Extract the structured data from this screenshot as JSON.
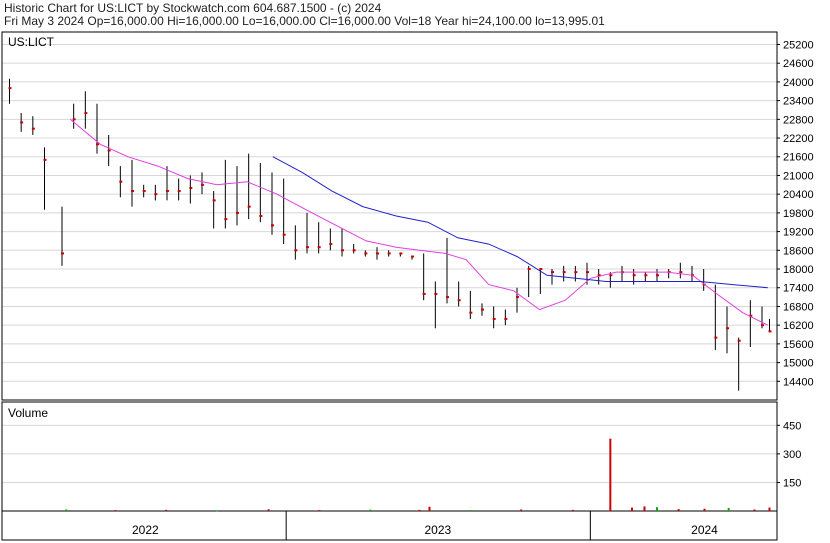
{
  "header": {
    "line1": "Historic Chart for US:LICT by Stockwatch.com 604.687.1500 - (c) 2024",
    "line2": "Fri May  3 2024  Op=16,000.00  Hi=16,000.00  Lo=16,000.00  Cl=16,000.00  Vol=18  Year hi=24,100.00  lo=13,995.01"
  },
  "colors": {
    "price_bars": "#000000",
    "close_marks": "#cc0000",
    "ma_short": "#e040e0",
    "ma_long": "#2222cc",
    "volume_up": "#00aa00",
    "volume_down": "#cc0000",
    "frame": "#000000",
    "grid": "#d8d8d8"
  },
  "chart_data": [
    {
      "type": "line",
      "title": "US:LICT",
      "ylim": [
        13800,
        25600
      ],
      "y_ticks": [
        14400,
        15000,
        15600,
        16200,
        16800,
        17400,
        18000,
        18600,
        19200,
        19800,
        20400,
        21000,
        21600,
        22200,
        22800,
        23400,
        24000,
        24600,
        25200
      ],
      "x_labels": [
        "2022",
        "2023",
        "2024"
      ],
      "grid": true,
      "series": [
        {
          "kind": "ohlc",
          "x": [
            "2021-11-03",
            "2021-11-17",
            "2021-12-01",
            "2021-12-15",
            "2022-01-05",
            "2022-01-19",
            "2022-02-02",
            "2022-02-16",
            "2022-03-02",
            "2022-03-16",
            "2022-03-30",
            "2022-04-13",
            "2022-04-27",
            "2022-05-11",
            "2022-05-25",
            "2022-06-08",
            "2022-06-22",
            "2022-07-06",
            "2022-07-20",
            "2022-08-03",
            "2022-08-17",
            "2022-08-31",
            "2022-09-14",
            "2022-09-28",
            "2022-10-12",
            "2022-10-26",
            "2022-11-09",
            "2022-11-23",
            "2022-12-07",
            "2022-12-21",
            "2023-01-04",
            "2023-01-18",
            "2023-02-01",
            "2023-02-15",
            "2023-03-01",
            "2023-03-15",
            "2023-03-29",
            "2023-04-12",
            "2023-04-26",
            "2023-05-10",
            "2023-05-24",
            "2023-06-07",
            "2023-06-21",
            "2023-07-05",
            "2023-07-19",
            "2023-08-02",
            "2023-08-16",
            "2023-08-30",
            "2023-09-13",
            "2023-09-27",
            "2023-10-11",
            "2023-10-25",
            "2023-11-08",
            "2023-11-22",
            "2023-12-06",
            "2023-12-20",
            "2024-01-03",
            "2024-01-17",
            "2024-01-31",
            "2024-02-14",
            "2024-02-28",
            "2024-03-13",
            "2024-03-27",
            "2024-04-10",
            "2024-04-24",
            "2024-05-03"
          ],
          "high": [
            24100,
            23000,
            22900,
            21900,
            20000,
            23300,
            23700,
            23300,
            22300,
            21300,
            21500,
            20700,
            20700,
            21300,
            20900,
            21000,
            21100,
            20500,
            21500,
            21300,
            21700,
            21400,
            21100,
            20900,
            19400,
            19800,
            19500,
            19300,
            19300,
            18800,
            18600,
            18700,
            18600,
            18500,
            18400,
            18500,
            17600,
            19000,
            17600,
            17300,
            16900,
            16800,
            16700,
            17400,
            18100,
            18000,
            18000,
            18100,
            18100,
            18200,
            18000,
            17900,
            18100,
            18000,
            17900,
            18000,
            18000,
            18200,
            18100,
            18000,
            17500,
            16800,
            15800,
            17000,
            16800,
            16400
          ],
          "low": [
            23300,
            22400,
            22300,
            19900,
            18100,
            22500,
            22500,
            21700,
            21300,
            20300,
            20000,
            20300,
            20200,
            20200,
            20200,
            20100,
            20400,
            19300,
            19300,
            19400,
            19600,
            19500,
            19100,
            18800,
            18300,
            18500,
            18500,
            18600,
            18400,
            18500,
            18400,
            18300,
            18400,
            18400,
            18300,
            17000,
            16100,
            16900,
            16800,
            16400,
            16500,
            16100,
            16200,
            16600,
            17100,
            17200,
            17500,
            17600,
            17600,
            17500,
            17500,
            17400,
            17600,
            17500,
            17600,
            17600,
            17700,
            17700,
            17600,
            17300,
            15400,
            15300,
            14100,
            15500,
            16100,
            16000
          ],
          "close": [
            23800,
            22700,
            22500,
            21500,
            18500,
            22800,
            23000,
            22000,
            21800,
            20800,
            20500,
            20500,
            20400,
            20500,
            20500,
            20600,
            20700,
            20200,
            19600,
            19800,
            20000,
            19700,
            19400,
            19100,
            18600,
            18700,
            18700,
            18800,
            18600,
            18600,
            18500,
            18500,
            18500,
            18500,
            18400,
            17200,
            17200,
            17100,
            17000,
            16600,
            16700,
            16400,
            16400,
            17100,
            18000,
            18000,
            17900,
            17900,
            17900,
            17900,
            17800,
            17800,
            17900,
            17800,
            17800,
            17800,
            17900,
            17900,
            17800,
            17500,
            15800,
            16100,
            15700,
            16500,
            16200,
            16000
          ]
        },
        {
          "kind": "line",
          "color_key": "ma_short",
          "x": [
            "2022-01-15",
            "2022-02-20",
            "2022-03-25",
            "2022-04-30",
            "2022-06-05",
            "2022-07-10",
            "2022-08-15",
            "2022-09-20",
            "2022-10-25",
            "2022-11-30",
            "2023-01-05",
            "2023-02-10",
            "2023-03-10",
            "2023-04-10",
            "2023-05-05",
            "2023-06-01",
            "2023-07-01",
            "2023-08-01",
            "2023-09-01",
            "2023-10-01",
            "2023-11-01",
            "2023-12-01",
            "2024-01-01",
            "2024-02-01",
            "2024-03-01",
            "2024-04-01",
            "2024-05-01"
          ],
          "values": [
            22800,
            22000,
            21600,
            21300,
            20900,
            20700,
            20800,
            20400,
            19900,
            19400,
            18900,
            18700,
            18600,
            18500,
            18300,
            17500,
            17300,
            16700,
            17000,
            17700,
            17900,
            17900,
            17900,
            17800,
            17200,
            16600,
            16200
          ]
        },
        {
          "kind": "line",
          "color_key": "ma_long",
          "x": [
            "2022-09-15",
            "2022-10-20",
            "2022-11-25",
            "2023-01-01",
            "2023-02-10",
            "2023-03-20",
            "2023-04-25",
            "2023-06-01",
            "2023-07-05",
            "2023-08-10",
            "2023-09-15",
            "2023-10-20",
            "2023-11-25",
            "2024-01-01",
            "2024-02-10",
            "2024-03-20",
            "2024-05-01"
          ],
          "values": [
            21600,
            21100,
            20500,
            20000,
            19700,
            19500,
            19000,
            18800,
            18400,
            17800,
            17700,
            17600,
            17600,
            17600,
            17600,
            17500,
            17400
          ]
        }
      ]
    },
    {
      "type": "bar",
      "title": "Volume",
      "ylim": [
        0,
        520
      ],
      "y_ticks": [
        150,
        300,
        450
      ],
      "x": [
        "2022-01-10",
        "2022-03-10",
        "2022-05-10",
        "2022-07-10",
        "2022-09-10",
        "2022-11-10",
        "2023-01-10",
        "2023-03-10",
        "2023-03-22",
        "2023-05-10",
        "2023-07-10",
        "2023-09-10",
        "2023-10-25",
        "2023-11-20",
        "2023-12-05",
        "2023-12-20",
        "2024-01-15",
        "2024-02-15",
        "2024-03-15",
        "2024-04-15",
        "2024-05-03"
      ],
      "values": [
        8,
        5,
        6,
        4,
        9,
        5,
        7,
        6,
        22,
        5,
        8,
        6,
        380,
        18,
        24,
        20,
        10,
        12,
        16,
        8,
        18
      ]
    }
  ]
}
